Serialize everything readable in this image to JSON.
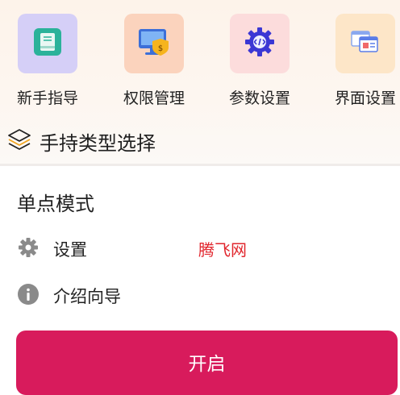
{
  "shortcuts": [
    {
      "label": "新手指导",
      "icon": "book-icon",
      "tile_color": "#d5cff7"
    },
    {
      "label": "权限管理",
      "icon": "monitor-shield-icon",
      "tile_color": "#fbd3bd"
    },
    {
      "label": "参数设置",
      "icon": "code-gear-icon",
      "tile_color": "#fcdcdc"
    },
    {
      "label": "界面设置",
      "icon": "windows-icon",
      "tile_color": "#fde6c8"
    }
  ],
  "section": {
    "title": "手持类型选择",
    "icon": "layers-icon"
  },
  "mode": {
    "title": "单点模式",
    "items": [
      {
        "label": "设置",
        "icon": "gear-icon"
      },
      {
        "label": "介绍向导",
        "icon": "info-icon"
      }
    ]
  },
  "watermark": "腾飞网",
  "start_button": "开启",
  "colors": {
    "accent": "#d81b5c",
    "watermark": "#e1262d"
  }
}
